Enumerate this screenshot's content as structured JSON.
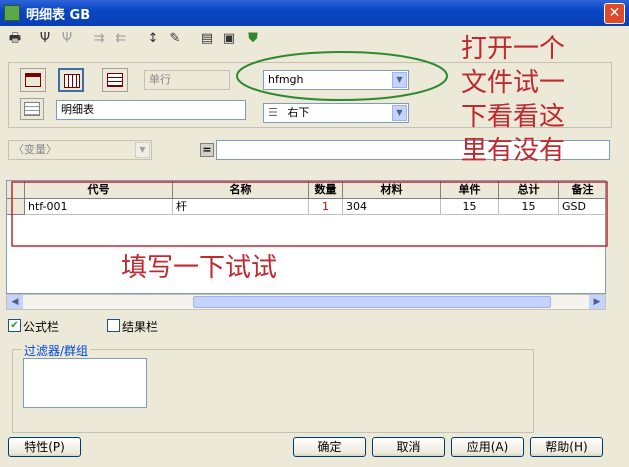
{
  "window": {
    "title": "明细表 GB",
    "close_glyph": "✕"
  },
  "toolbar": [
    {
      "icon": "print-icon",
      "glyph": "🖶",
      "enabled": true
    },
    {
      "icon": "filter-tree-icon",
      "glyph": "Ψ",
      "enabled": true
    },
    {
      "icon": "filter-tree-alt-icon",
      "glyph": "Ψ",
      "enabled": false
    },
    {
      "icon": "collapse-icon",
      "glyph": "⇉",
      "enabled": false
    },
    {
      "icon": "expand-icon",
      "glyph": "⇇",
      "enabled": false
    },
    {
      "icon": "sort-icon",
      "glyph": "↕",
      "enabled": true
    },
    {
      "icon": "edit-icon",
      "glyph": "✎",
      "enabled": true
    },
    {
      "icon": "copy-icon",
      "glyph": "▤",
      "enabled": true
    },
    {
      "icon": "save-icon",
      "glyph": "▣",
      "enabled": true
    },
    {
      "icon": "shield-icon",
      "glyph": "⛊",
      "enabled": true
    }
  ],
  "settings": {
    "row_mode": "单行",
    "template_value": "hfmgh",
    "table_name": "明细表",
    "position_value": "右下",
    "variable_placeholder": "〈变量〉",
    "equals": "=",
    "expression": ""
  },
  "table": {
    "columns": [
      "代号",
      "名称",
      "数量",
      "材料",
      "单件",
      "总计",
      "备注"
    ],
    "rows": [
      [
        "htf-001",
        "杆",
        "1",
        "304",
        "15",
        "15",
        "GSD"
      ]
    ]
  },
  "options": {
    "formula_bar_label": "公式栏",
    "formula_bar_checked": true,
    "result_bar_label": "结果栏",
    "result_bar_checked": false
  },
  "filter_group_label": "过滤器/群组",
  "buttons": {
    "properties": "特性(P)",
    "ok": "确定",
    "cancel": "取消",
    "apply": "应用(A)",
    "help": "帮助(H)"
  },
  "annotations": {
    "note1": "打开一个\n文件试一\n下看看这\n里有没有",
    "note2": "填写一下试试",
    "color": "#c0292f",
    "oval_color": "#2f8a2f"
  }
}
